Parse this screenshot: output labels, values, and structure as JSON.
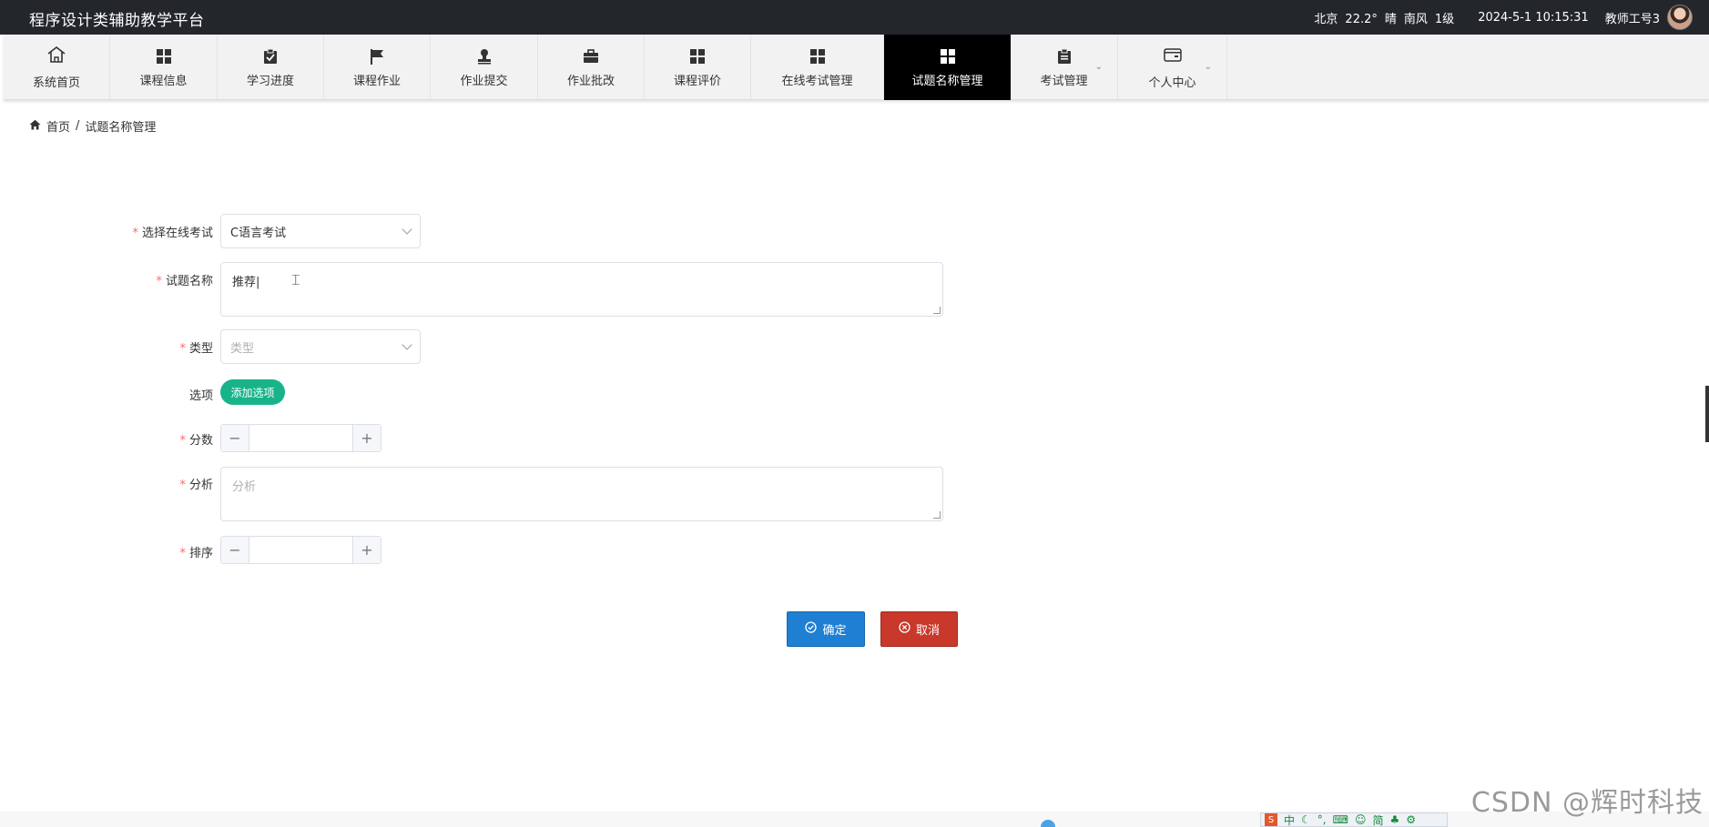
{
  "app": {
    "title": "程序设计类辅助教学平台",
    "weather": {
      "city": "北京",
      "temperature": "22.2°",
      "condition": "晴",
      "wind": "南风",
      "wind_level": "1级"
    },
    "datetime": "2024-5-1 10:15:31",
    "user": "教师工号3"
  },
  "nav": {
    "items": [
      {
        "label": "系统首页",
        "icon": "home-icon"
      },
      {
        "label": "课程信息",
        "icon": "grid-icon"
      },
      {
        "label": "学习进度",
        "icon": "clipboard-check-icon"
      },
      {
        "label": "课程作业",
        "icon": "flag-icon"
      },
      {
        "label": "作业提交",
        "icon": "stamp-icon"
      },
      {
        "label": "作业批改",
        "icon": "briefcase-icon"
      },
      {
        "label": "课程评价",
        "icon": "grid-icon"
      },
      {
        "label": "在线考试管理",
        "icon": "grid-icon"
      },
      {
        "label": "试题名称管理",
        "icon": "grid-icon",
        "active": true
      },
      {
        "label": "考试管理",
        "icon": "clipboard-icon",
        "dropdown": true
      },
      {
        "label": "个人中心",
        "icon": "wallet-icon",
        "dropdown": true
      }
    ]
  },
  "breadcrumb": {
    "home": "首页",
    "separator": "/",
    "current": "试题名称管理"
  },
  "form": {
    "exam": {
      "label": "选择在线考试",
      "value": "C语言考试"
    },
    "question_name": {
      "label": "试题名称",
      "value": "推荐|"
    },
    "type": {
      "label": "类型",
      "placeholder": "类型"
    },
    "options": {
      "label": "选项",
      "add_button": "添加选项"
    },
    "score": {
      "label": "分数",
      "value": ""
    },
    "analysis": {
      "label": "分析",
      "placeholder": "分析"
    },
    "order": {
      "label": "排序",
      "value": ""
    },
    "required_mark": "*",
    "confirm": "确定",
    "cancel": "取消"
  },
  "ime": {
    "mode": "中",
    "simplified": "简"
  },
  "watermark": "CSDN @辉时科技",
  "colors": {
    "topbar": "#23262b",
    "active_nav": "#000000",
    "confirm": "#1f7fd3",
    "cancel": "#c8382b",
    "add_option": "#19b38a",
    "required": "#f56c6c"
  }
}
